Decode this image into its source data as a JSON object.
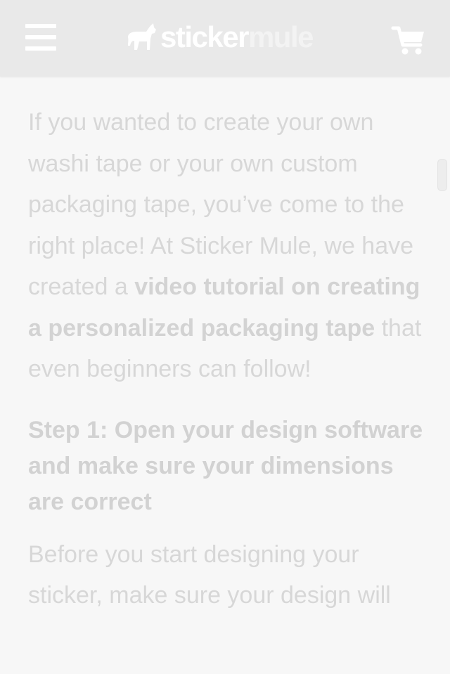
{
  "header": {
    "menu_icon": "hamburger-menu-icon",
    "logo": {
      "part1": "sticker",
      "part2": "mule",
      "mark_icon": "mule-icon"
    },
    "cart_icon": "shopping-cart-icon"
  },
  "article": {
    "intro": {
      "text1": "If you wanted to create your own washi tape or your own custom packaging tape, you’ve come to the right place! At Sticker Mule, we have created a ",
      "link": "video tutorial on creating a personalized packaging tape",
      "text2": " that even beginners can follow!"
    },
    "step1_heading": "Step 1: Open your design software and make sure your dimensions are correct",
    "step1_body": "Before you start designing your sticker, make sure your design will"
  },
  "colors": {
    "header_bg": "#e9e9e9",
    "page_bg": "#f7f7f7",
    "text": "#d7d7d7"
  }
}
